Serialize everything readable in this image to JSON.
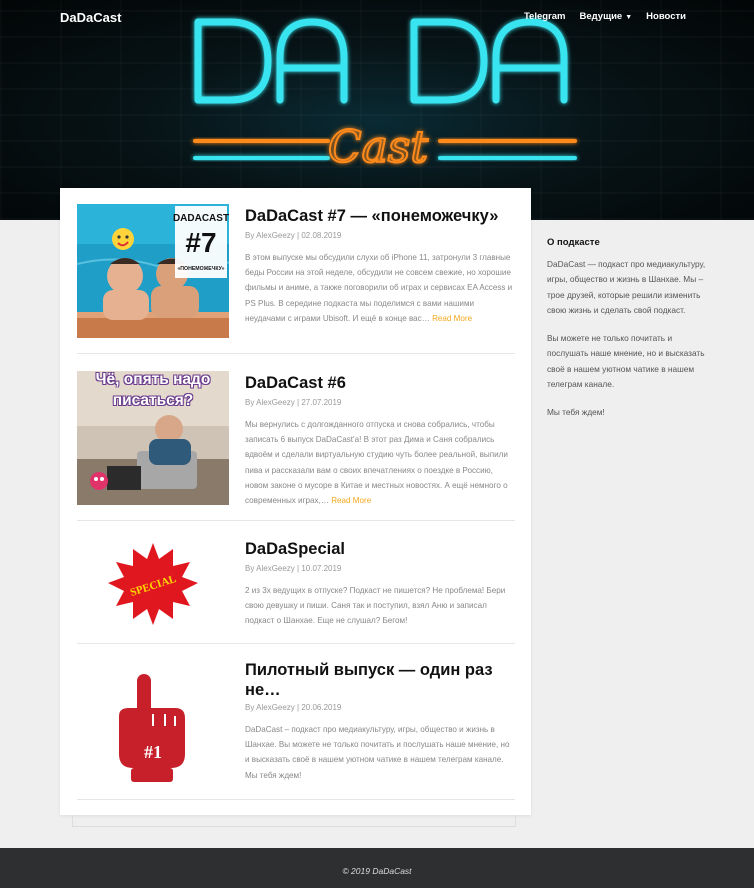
{
  "site": {
    "title": "DaDaCast"
  },
  "nav": {
    "items": [
      {
        "label": "Telegram"
      },
      {
        "label": "Ведущие"
      },
      {
        "label": "Новости"
      }
    ]
  },
  "hero": {
    "logo_main": "DA DA",
    "logo_script": "Cast"
  },
  "posts": [
    {
      "title": "DaDaCast #7 — «понеможечку»",
      "author": "AlexGeezy",
      "date": "02.08.2019",
      "excerpt": "В этом выпуске мы обсудили слухи об iPhone 11, затронули 3 главные беды России на этой неделе, обсудили не совсем свежие, но хорошие фильмы и аниме, а также поговорили об играх и сервисах EA Access и PS Plus. В середине подкаста мы поделимся с вами нашими неудачами с играми Ubisoft. И ещё в конце вас…",
      "read_more": "Read More",
      "thumb": {
        "brand": "DADACAST",
        "number": "#7",
        "subtitle": "«ПОНЕМОЖЕЧКУ»"
      }
    },
    {
      "title": "DaDaCast #6",
      "author": "AlexGeezy",
      "date": "27.07.2019",
      "excerpt": "Мы вернулись с долгожданного отпуска и снова собрались, чтобы записать 6 выпуск DaDaCast'а! В этот раз Дима и Саня собрались вдвоём и сделали виртуальную студию чуть более реальной, выпили пива и рассказали вам о своих впечатлениях о поездке в Россию, новом законе о мусоре в Китае и местных новостях. А ещё немного о современных играх,…",
      "read_more": "Read More",
      "thumb": {
        "caption": "Чё, опять надо писаться?"
      }
    },
    {
      "title": "DaDaSpecial",
      "author": "AlexGeezy",
      "date": "10.07.2019",
      "excerpt": "2 из 3х ведущих в отпуске? Подкаст не пишется? Не проблема! Бери свою девушку и пиши. Саня так и поступил, взял Аню и записал подкаст о Шанхае. Еще не слушал? Бегом!",
      "thumb": {
        "badge": "SPECIAL"
      }
    },
    {
      "title": "Пилотный выпуск — один раз не…",
      "author": "AlexGeezy",
      "date": "20.06.2019",
      "excerpt": "DaDaCast – подкаст про медиакультуру, игры, общество и жизнь в Шанхае. Вы можете не только почитать и послушать наше мнение, но и высказать своё в нашем уютном чатике в нашем телеграм канале. Мы тебя ждем!",
      "thumb": {
        "badge": "#1"
      }
    }
  ],
  "sidebar": {
    "title": "О подкасте",
    "p1": "DaDaCast — подкаст про медиакультуру, игры, общество и жизнь в Шанхае. Мы – трое друзей, которые решили изменить свою жизнь и сделать свой подкаст.",
    "p2": "Вы можете не только почитать и послушать наше мнение, но и высказать своё в нашем уютном чатике в нашем телеграм канале.",
    "p3": "Мы тебя ждем!"
  },
  "footer": {
    "text": "© 2019 DaDaCast"
  },
  "colors": {
    "neon_cyan": "#38e4f0",
    "neon_orange": "#ff8a1a",
    "accent": "#f2a81d",
    "footer_bg": "#2e2f30"
  }
}
